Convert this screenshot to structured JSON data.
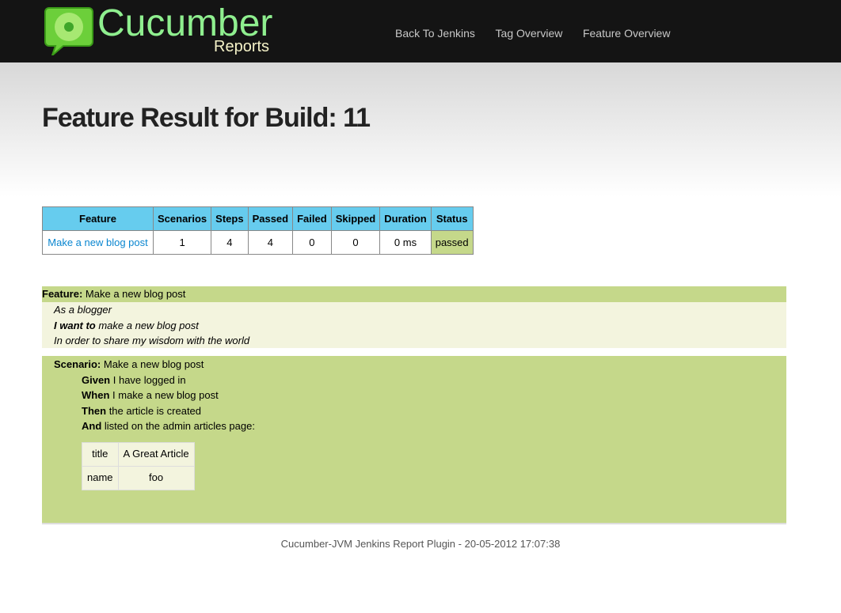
{
  "header": {
    "logo_word": "Cucumber",
    "logo_sub": "Reports",
    "nav": [
      "Back To Jenkins",
      "Tag Overview",
      "Feature Overview"
    ]
  },
  "title": "Feature Result for Build: 11",
  "stats": {
    "columns": [
      "Feature",
      "Scenarios",
      "Steps",
      "Passed",
      "Failed",
      "Skipped",
      "Duration",
      "Status"
    ],
    "row": {
      "feature": "Make a new blog post",
      "scenarios": "1",
      "steps": "4",
      "passed": "4",
      "failed": "0",
      "skipped": "0",
      "duration": "0 ms",
      "status": "passed"
    },
    "colors": {
      "header": "#66ccee",
      "passed": "#c5d88a"
    }
  },
  "feature": {
    "keyword": "Feature:",
    "name": "Make a new blog post",
    "as": "As a blogger",
    "want_kw": "I want to",
    "want": "make a new blog post",
    "order": "In order to share my wisdom with the world"
  },
  "scenario": {
    "keyword": "Scenario:",
    "name": "Make a new blog post",
    "steps": [
      {
        "kw": "Given",
        "text": "I have logged in"
      },
      {
        "kw": "When",
        "text": "I make a new blog post"
      },
      {
        "kw": "Then",
        "text": "the article is created"
      },
      {
        "kw": "And",
        "text": "listed on the admin articles page:"
      }
    ],
    "table": [
      [
        "title",
        "A Great Article"
      ],
      [
        "name",
        "foo"
      ]
    ]
  },
  "footer": "Cucumber-JVM Jenkins Report Plugin - 20-05-2012 17:07:38"
}
